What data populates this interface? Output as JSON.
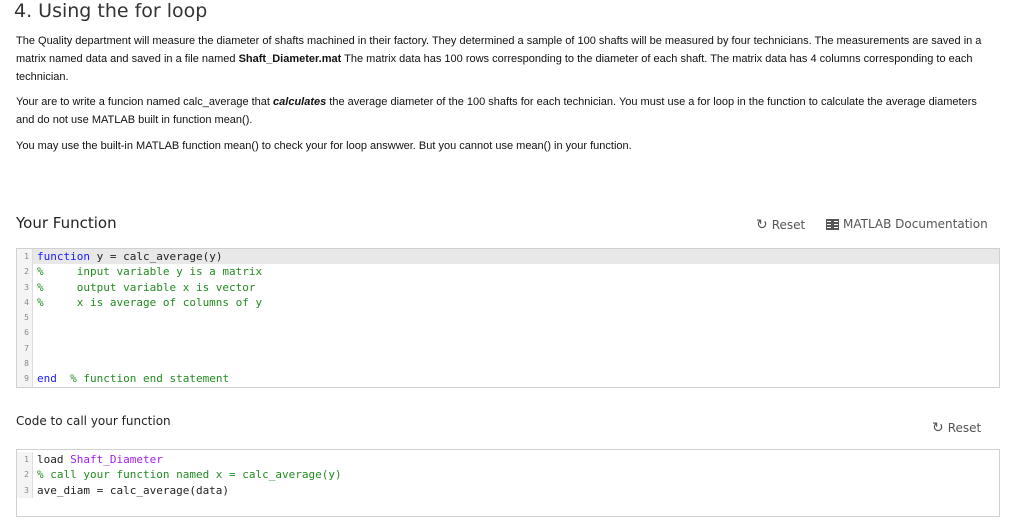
{
  "problem": {
    "title": "4. Using the for loop",
    "p1_a": "The Quality department will measure the diameter of shafts  machined in their factory.  They determined a sample of 100 shafts will be measured by four technicians.  The measurements are saved in a matrix named data and saved in a file named ",
    "p1_file": "Shaft_Diameter.mat",
    "p1_b": "  The matrix data has 100 rows corresponding to the diameter of each shaft.  The matrix data has 4 columns corresponding to each technician.",
    "p2_a": "Your are to write a funcion named calc_average that ",
    "p2_em": "calculates",
    "p2_b": " the average diameter of the 100 shafts for each technician.  You must use a for loop in the function to calculate the average diameters and do not use MATLAB built in function mean().",
    "p3": "You may use the built-in MATLAB function mean() to check your for loop answwer.  But you cannot use mean() in your function."
  },
  "your_function": {
    "heading": "Your Function",
    "reset_label": "Reset",
    "docs_label": "MATLAB Documentation",
    "lines": [
      {
        "n": "1",
        "parts": [
          {
            "t": "function",
            "c": "kw"
          },
          {
            "t": " y = calc_average(y)",
            "c": ""
          }
        ]
      },
      {
        "n": "2",
        "parts": [
          {
            "t": "%     input variable y is a matrix",
            "c": "cm"
          }
        ]
      },
      {
        "n": "3",
        "parts": [
          {
            "t": "%     output variable x is vector",
            "c": "cm"
          }
        ]
      },
      {
        "n": "4",
        "parts": [
          {
            "t": "%     x is average of columns of y",
            "c": "cm"
          }
        ]
      },
      {
        "n": "5",
        "parts": []
      },
      {
        "n": "6",
        "parts": []
      },
      {
        "n": "7",
        "parts": []
      },
      {
        "n": "8",
        "parts": []
      },
      {
        "n": "9",
        "parts": [
          {
            "t": "end",
            "c": "kw"
          },
          {
            "t": "  ",
            "c": ""
          },
          {
            "t": "% function end statement",
            "c": "cm"
          }
        ]
      }
    ]
  },
  "call_function": {
    "heading": "Code to call your function",
    "reset_label": "Reset",
    "lines": [
      {
        "n": "1",
        "parts": [
          {
            "t": "load ",
            "c": ""
          },
          {
            "t": "Shaft_Diameter",
            "c": "str"
          }
        ]
      },
      {
        "n": "2",
        "parts": [
          {
            "t": "% call your function named x = calc_average(y)",
            "c": "cm"
          }
        ]
      },
      {
        "n": "3",
        "parts": [
          {
            "t": "ave_diam = calc_average(data)",
            "c": ""
          }
        ]
      }
    ]
  },
  "icons": {
    "reset": "refresh-icon",
    "docs": "book-icon"
  }
}
